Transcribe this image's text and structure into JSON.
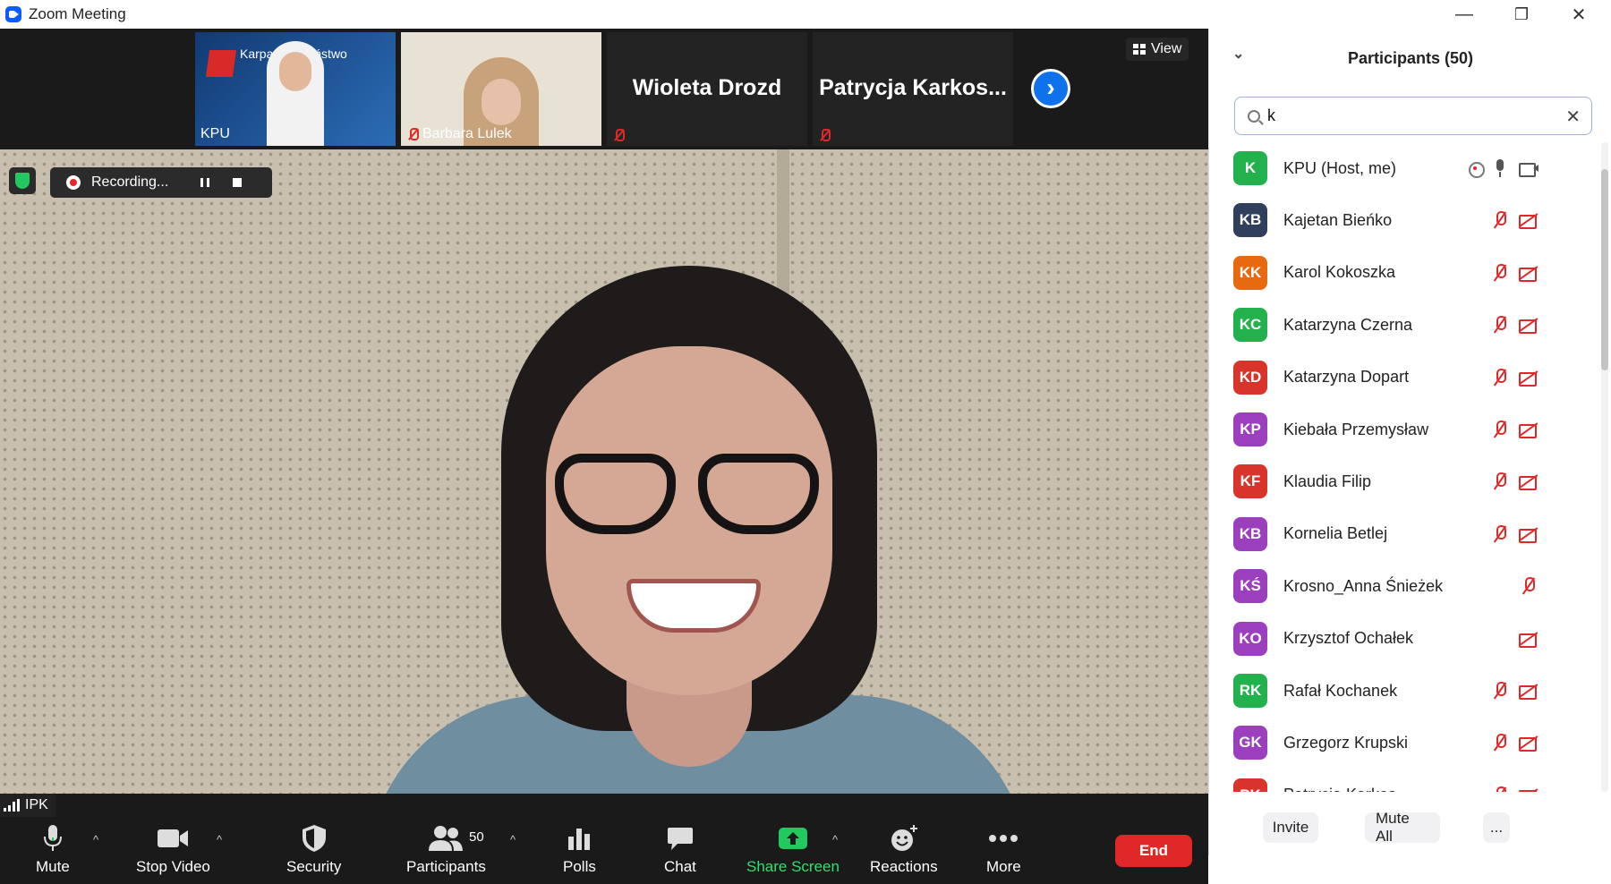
{
  "window": {
    "title": "Zoom Meeting",
    "minimize": "—",
    "restore": "❐",
    "close": "✕"
  },
  "strip": {
    "thumbs": [
      {
        "label": "KPU",
        "overlay": "Karpackie Państwowa Uczelnia w Krośnie",
        "muted": false
      },
      {
        "label": "Barbara Lulek",
        "muted": true
      },
      {
        "label": "Wioleta Drozd",
        "muted": true
      },
      {
        "label": "Patrycja  Karkos...",
        "muted": true
      }
    ],
    "next": "›",
    "view_label": "View"
  },
  "recording": {
    "text": "Recording..."
  },
  "speaker": {
    "name": "IPK"
  },
  "toolbar": {
    "mute": "Mute",
    "stop_video": "Stop Video",
    "security": "Security",
    "participants": "Participants",
    "participants_count": "50",
    "polls": "Polls",
    "chat": "Chat",
    "share_screen": "Share Screen",
    "reactions": "Reactions",
    "more": "More",
    "end": "End",
    "caret": "^"
  },
  "panel": {
    "title": "Participants (50)",
    "search_value": "k",
    "participants": [
      {
        "initials": "K",
        "name": "KPU (Host, me)",
        "color": "#23b14d",
        "mic": "on",
        "cam": "on",
        "rec": true
      },
      {
        "initials": "KB",
        "name": "Kajetan Bieńko",
        "color": "#2f3f5c",
        "mic": "off",
        "cam": "off"
      },
      {
        "initials": "KK",
        "name": "Karol Kokoszka",
        "color": "#e86a10",
        "mic": "off",
        "cam": "off"
      },
      {
        "initials": "KC",
        "name": "Katarzyna Czerna",
        "color": "#23b14d",
        "mic": "off",
        "cam": "off"
      },
      {
        "initials": "KD",
        "name": "Katarzyna Dopart",
        "color": "#d9342b",
        "mic": "off",
        "cam": "off"
      },
      {
        "initials": "KP",
        "name": "Kiebała Przemysław",
        "color": "#9c3fbf",
        "mic": "off",
        "cam": "off"
      },
      {
        "initials": "KF",
        "name": "Klaudia Filip",
        "color": "#d9342b",
        "mic": "off",
        "cam": "off"
      },
      {
        "initials": "KB",
        "name": "Kornelia Betlej",
        "color": "#9c3fbf",
        "mic": "off",
        "cam": "off"
      },
      {
        "initials": "KŚ",
        "name": "Krosno_Anna Śnieżek",
        "color": "#9c3fbf",
        "mic": "off",
        "cam": "none"
      },
      {
        "initials": "KO",
        "name": "Krzysztof Ochałek",
        "color": "#9c3fbf",
        "mic": "none",
        "cam": "off"
      },
      {
        "initials": "RK",
        "name": "Rafał Kochanek",
        "color": "#23b14d",
        "mic": "off",
        "cam": "off"
      },
      {
        "initials": "GK",
        "name": "Grzegorz Krupski",
        "color": "#9c3fbf",
        "mic": "off",
        "cam": "off"
      },
      {
        "initials": "PK",
        "name": "Patrycja Karkos...",
        "color": "#d9342b",
        "mic": "off",
        "cam": "off"
      }
    ],
    "invite": "Invite",
    "mute_all": "Mute All",
    "more": "..."
  }
}
